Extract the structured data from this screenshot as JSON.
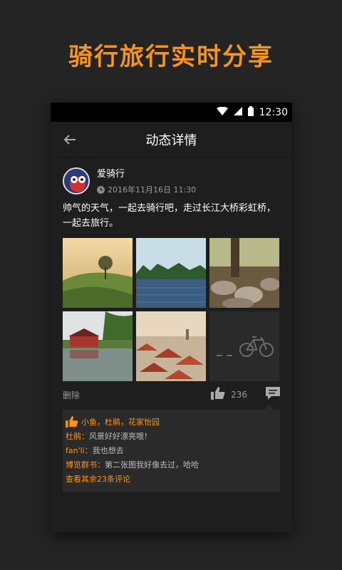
{
  "promo": {
    "title": "骑行旅行实时分享"
  },
  "statusbar": {
    "time": "12:30"
  },
  "appbar": {
    "title": "动态详情"
  },
  "post": {
    "author": "爱骑行",
    "time": "2016年11月16日 11:30",
    "text": "帅气的天气，一起去骑行吧，走过长江大桥彩虹桥，一起去旅行。",
    "images": [
      "golden-hill-photo",
      "lake-photo",
      "rocky-forest-photo",
      "red-house-lake-photo",
      "red-roof-town-photo",
      "bicycle-placeholder"
    ]
  },
  "actions": {
    "delete_label": "删除",
    "like_count": "236"
  },
  "likes": {
    "names": "小鱼，杜鹃，花家怡园"
  },
  "comments": [
    {
      "name": "杜鹃：",
      "text": "风景好好漂亮哦！"
    },
    {
      "name": "fan'li：",
      "text": "我也想去"
    },
    {
      "name": "博览群书：",
      "text": "第二张图我好像去过，哈哈"
    }
  ],
  "more_comments": "查看其余23条评论",
  "colors": {
    "accent": "#f7941d",
    "background": "#242424",
    "card": "#1e1e1e"
  }
}
